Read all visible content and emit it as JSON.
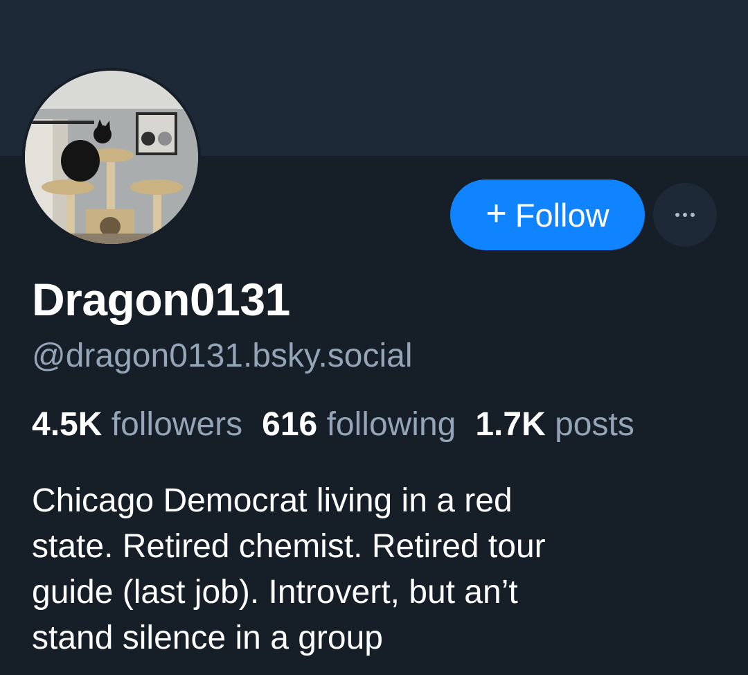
{
  "profile": {
    "display_name": "Dragon0131",
    "handle": "@dragon0131.bsky.social",
    "avatar_icon": "cat-tree-photo",
    "bio": "Chicago Democrat living in a red\nstate. Retired chemist. Retired tour\nguide (last job). Introvert, but an’t\nstand silence in a group"
  },
  "actions": {
    "follow_plus": "+",
    "follow_label": "Follow",
    "more_icon": "ellipsis-icon"
  },
  "stats": {
    "followers_count": "4.5K",
    "followers_label": "followers",
    "following_count": "616",
    "following_label": "following",
    "posts_count": "1.7K",
    "posts_label": "posts"
  },
  "colors": {
    "accent": "#1083fe",
    "background": "#161e27",
    "banner": "#1e2937",
    "secondary_text": "#93a5b7"
  }
}
